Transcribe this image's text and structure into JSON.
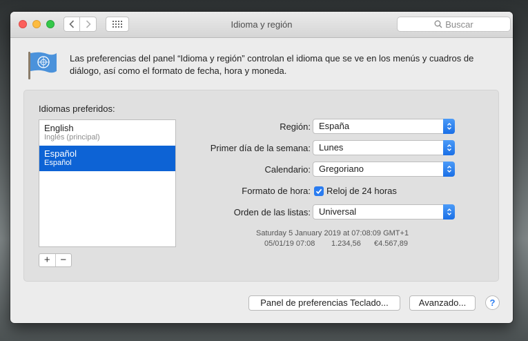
{
  "window": {
    "title": "Idioma y región",
    "search_placeholder": "Buscar"
  },
  "description": "Las preferencias del panel “Idioma y región” controlan el idioma que se ve en los menús y cuadros de diálogo, así como el formato de fecha, hora y moneda.",
  "languages": {
    "label": "Idiomas preferidos:",
    "items": [
      {
        "name": "English",
        "subtitle": "Inglés (principal)",
        "selected": false
      },
      {
        "name": "Español",
        "subtitle": "Español",
        "selected": true
      }
    ],
    "add_label": "+",
    "remove_label": "−"
  },
  "settings": {
    "region_label": "Región:",
    "region_value": "España",
    "first_day_label": "Primer día de la semana:",
    "first_day_value": "Lunes",
    "calendar_label": "Calendario:",
    "calendar_value": "Gregoriano",
    "time_format_label": "Formato de hora:",
    "time_format_checkbox": "Reloj de 24 horas",
    "time_format_checked": true,
    "list_order_label": "Orden de las listas:",
    "list_order_value": "Universal"
  },
  "sample": {
    "line1": "Saturday 5 January 2019 at 07:08:09 GMT+1",
    "line2_date": "05/01/19 07:08",
    "line2_number": "1.234,56",
    "line2_currency": "€4.567,89"
  },
  "buttons": {
    "keyboard": "Panel de preferencias Teclado...",
    "advanced": "Avanzado...",
    "help": "?"
  },
  "colors": {
    "accent": "#0d63d5",
    "close": "#fc605c",
    "minimize": "#fdbc40",
    "zoom": "#34c84a"
  }
}
